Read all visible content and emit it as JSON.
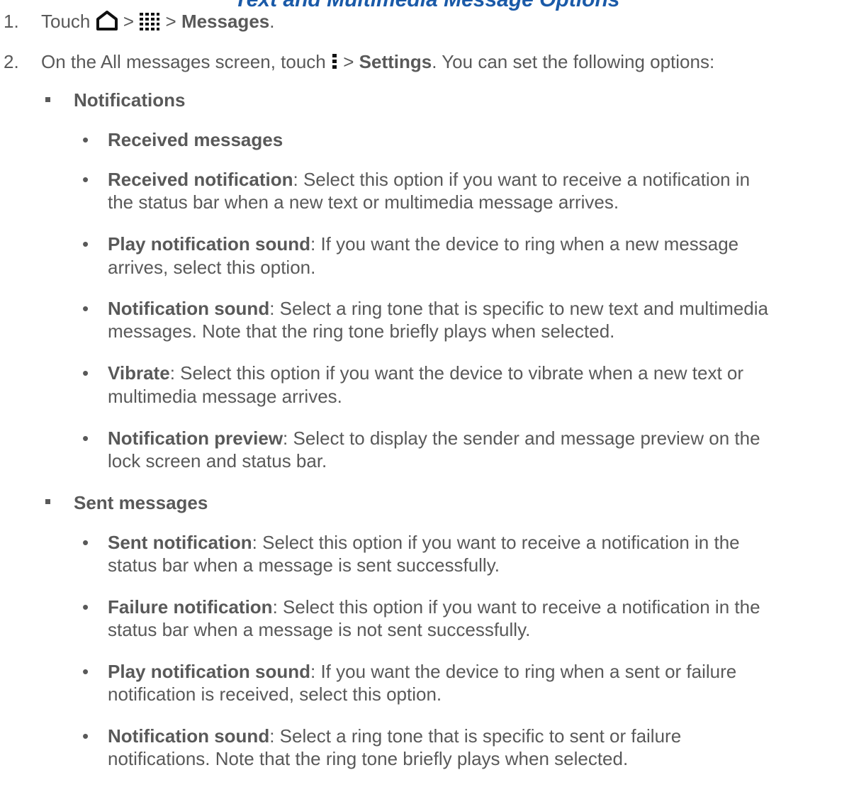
{
  "heading_fragment": "Text and Multimedia Message Options",
  "steps": [
    {
      "number": "1.",
      "prefix": "Touch",
      "sep1": ">",
      "sep2": ">",
      "target": "Messages",
      "end": ".",
      "icons": [
        "home-icon",
        "apps-grid-icon"
      ]
    },
    {
      "number": "2.",
      "prefix": "On the All messages screen, touch",
      "sep": ">",
      "target": "Settings",
      "suffix": ". You can set the following options:",
      "icons": [
        "menu-dots-icon"
      ]
    }
  ],
  "sections": [
    {
      "title": "Notifications",
      "items": [
        {
          "label": "Received messages",
          "lines": []
        },
        {
          "label": "Received notification",
          "lines": [
            ": Select this option if you want to receive a notification in",
            "the status bar when a new text or multimedia message arrives."
          ]
        },
        {
          "label": "Play notification sound",
          "lines": [
            ": If you want the device to ring when a new message",
            "arrives, select this option."
          ]
        },
        {
          "label": "Notification sound",
          "lines": [
            ": Select a ring tone that is specific to new text and multimedia",
            "messages. Note that the ring tone briefly plays when selected."
          ]
        },
        {
          "label": "Vibrate",
          "lines": [
            ": Select this option if you want the device to vibrate when a new text or",
            "multimedia message arrives."
          ]
        },
        {
          "label": "Notification preview",
          "lines": [
            ": Select to display the sender and message preview on the",
            "lock screen and status bar."
          ]
        }
      ]
    },
    {
      "title": "Sent messages",
      "items": [
        {
          "label": "Sent notification",
          "lines": [
            ": Select this option if you want to receive a notification in the",
            "status bar when a message is sent successfully."
          ]
        },
        {
          "label": "Failure notification",
          "lines": [
            ": Select this option if you want to receive a notification in the",
            "status bar when a message is not sent successfully."
          ]
        },
        {
          "label": "Play notification sound",
          "lines": [
            ": If you want the device to ring when a sent or failure",
            "notification is received, select this option."
          ]
        },
        {
          "label": "Notification sound",
          "lines": [
            ": Select a ring tone that is specific to sent or failure",
            "notifications. Note that the ring tone briefly plays when selected."
          ]
        }
      ]
    }
  ]
}
